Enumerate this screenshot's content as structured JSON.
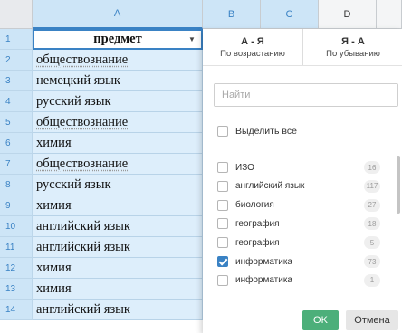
{
  "sheet": {
    "columns": [
      "A",
      "B",
      "C",
      "D"
    ],
    "header": {
      "row": "1",
      "value": "предмет"
    },
    "rows": [
      {
        "num": "2",
        "value": "обществознание",
        "underline": true
      },
      {
        "num": "3",
        "value": "немецкий язык",
        "underline": false
      },
      {
        "num": "4",
        "value": "русский язык",
        "underline": false
      },
      {
        "num": "5",
        "value": "обществознание",
        "underline": true
      },
      {
        "num": "6",
        "value": "химия",
        "underline": false
      },
      {
        "num": "7",
        "value": "обществознание",
        "underline": true
      },
      {
        "num": "8",
        "value": "русский язык",
        "underline": false
      },
      {
        "num": "9",
        "value": "химия",
        "underline": false
      },
      {
        "num": "10",
        "value": "английский язык",
        "underline": false
      },
      {
        "num": "11",
        "value": "английский язык",
        "underline": false
      },
      {
        "num": "12",
        "value": "химия",
        "underline": false
      },
      {
        "num": "13",
        "value": "химия",
        "underline": false
      },
      {
        "num": "14",
        "value": "английский язык",
        "underline": false
      }
    ]
  },
  "filter": {
    "sort_asc": {
      "title": "А - Я",
      "subtitle": "По возрастанию"
    },
    "sort_desc": {
      "title": "Я - А",
      "subtitle": "По убыванию"
    },
    "search_placeholder": "Найти",
    "select_all": "Выделить все",
    "items": [
      {
        "label": "ИЗО",
        "count": "16",
        "checked": false
      },
      {
        "label": "английский язык",
        "count": "117",
        "checked": false
      },
      {
        "label": "биология",
        "count": "27",
        "checked": false
      },
      {
        "label": "география",
        "count": "18",
        "checked": false
      },
      {
        "label": "география",
        "count": "5",
        "checked": false
      },
      {
        "label": "информатика",
        "count": "73",
        "checked": true
      },
      {
        "label": "информатика",
        "count": "1",
        "checked": false
      }
    ],
    "ok": "OK",
    "cancel": "Отмена"
  },
  "colors": {
    "accent": "#3a82c4",
    "ok_button": "#4caf7a",
    "selection": "#ddeefb"
  }
}
